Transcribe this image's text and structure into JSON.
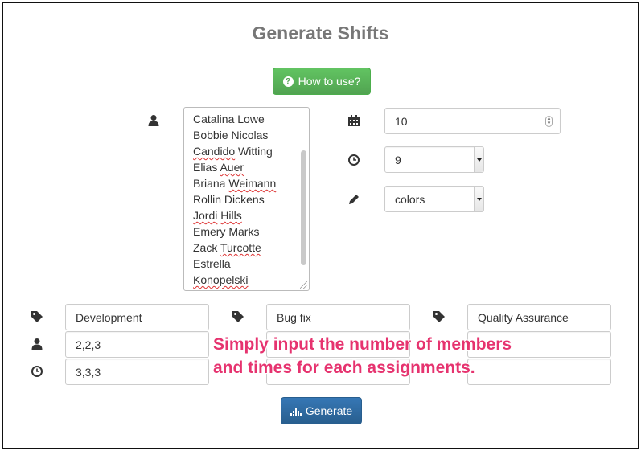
{
  "page": {
    "title": "Generate Shifts"
  },
  "howto_button": {
    "label": "How to use?",
    "icon": "question-circle-icon",
    "color": "#5cb85c"
  },
  "members": {
    "icon": "user-icon",
    "items": [
      "Catalina Lowe",
      "Bobbie Nicolas",
      "Candido Witting",
      "Elias Auer",
      "Briana Weimann",
      "Rollin Dickens",
      "Jordi Hills",
      "Emery Marks",
      "Zack Turcotte",
      "Estrella",
      "Konopelski"
    ]
  },
  "settings": {
    "days": {
      "icon": "calendar-icon",
      "value": "10"
    },
    "hours": {
      "icon": "clock-icon",
      "value": "9"
    },
    "style": {
      "icon": "pencil-icon",
      "value": "colors"
    }
  },
  "assignments": [
    {
      "name": "Development",
      "members": "2,2,3",
      "times": "3,3,3"
    },
    {
      "name": "Bug fix",
      "members": "",
      "times": ""
    },
    {
      "name": "Quality Assurance",
      "members": "",
      "times": ""
    }
  ],
  "assignment_icons": {
    "name": "tag-icon",
    "members": "user-icon",
    "times": "clock-icon"
  },
  "generate_button": {
    "label": "Generate",
    "icon": "tasks-icon",
    "color": "#2e6da4"
  },
  "overlay": {
    "line1": "Simply input the number of members",
    "line2": "and times for each assignments.",
    "color": "#e6336f"
  }
}
